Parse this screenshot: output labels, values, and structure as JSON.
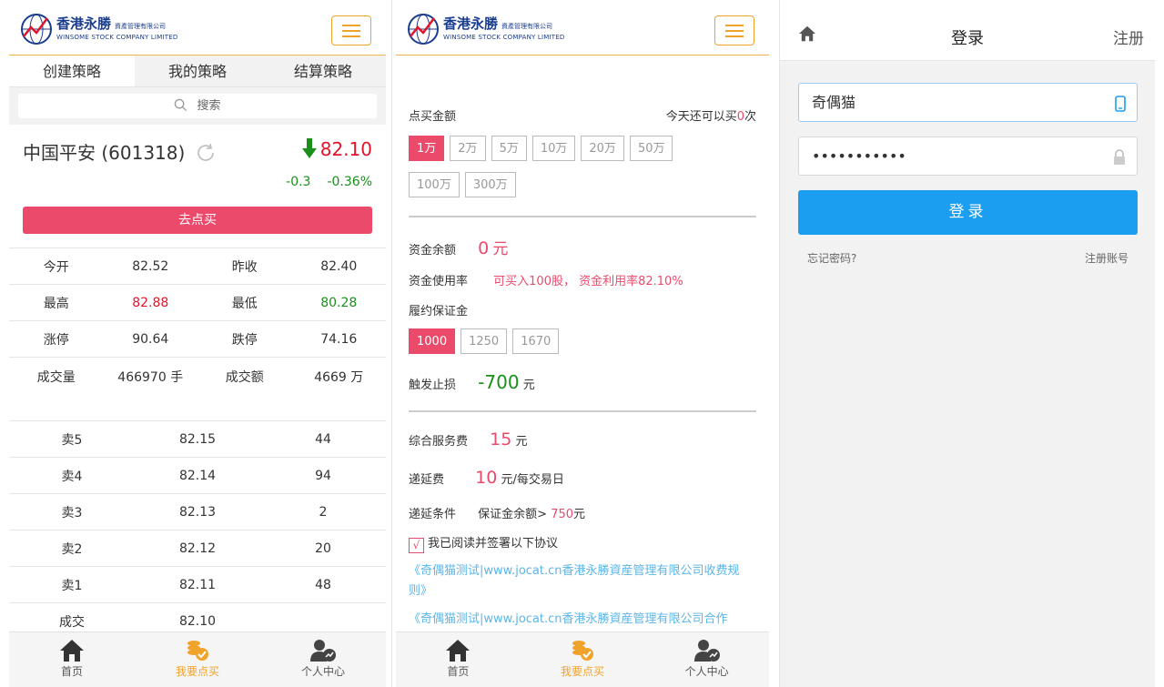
{
  "brand": {
    "name_cn": "香港永勝",
    "name_cn_small": "資產管理有限公司",
    "name_en": "WINSOME STOCK COMPANY LIMITED"
  },
  "left": {
    "tabs": [
      "创建策略",
      "我的策略",
      "结算策略"
    ],
    "search_label": "搜索",
    "stock_name": "中国平安 (601318)",
    "price": "82.10",
    "change": "-0.3",
    "change_pct": "-0.36%",
    "buy_button": "去点买",
    "quote_rows": [
      {
        "k1": "今开",
        "v1": "82.52",
        "k2": "昨收",
        "v2": "82.40"
      },
      {
        "k1": "最高",
        "v1": "82.88",
        "k2": "最低",
        "v2": "80.28"
      },
      {
        "k1": "涨停",
        "v1": "90.64",
        "k2": "跌停",
        "v2": "74.16"
      },
      {
        "k1": "成交量",
        "v1": "466970 手",
        "k2": "成交额",
        "v2": "4669 万"
      }
    ],
    "orders": [
      {
        "label": "卖5",
        "price": "82.15",
        "vol": "44"
      },
      {
        "label": "卖4",
        "price": "82.14",
        "vol": "94"
      },
      {
        "label": "卖3",
        "price": "82.13",
        "vol": "2"
      },
      {
        "label": "卖2",
        "price": "82.12",
        "vol": "20"
      },
      {
        "label": "卖1",
        "price": "82.11",
        "vol": "48"
      },
      {
        "label": "成交",
        "price": "82.10",
        "vol": ""
      }
    ]
  },
  "nav": {
    "home": "首页",
    "buy": "我要点买",
    "me": "个人中心"
  },
  "middle": {
    "amount_label": "点买金额",
    "remaining_prefix": "今天还可以买",
    "remaining_count": "0",
    "remaining_suffix": "次",
    "amounts": [
      "1万",
      "2万",
      "5万",
      "10万",
      "20万",
      "50万",
      "100万",
      "300万"
    ],
    "balance_label": "资金余额",
    "balance_value": "0",
    "balance_unit": "元",
    "usage_label": "资金使用率",
    "usage_value": "可买入100股， 资金利用率82.10%",
    "margin_label": "履约保证金",
    "margins": [
      "1000",
      "1250",
      "1670"
    ],
    "stoploss_label": "触发止损",
    "stoploss_value": "-700",
    "stoploss_unit": "元",
    "fee_label": "综合服务费",
    "fee_value": "15",
    "fee_unit": "元",
    "defer_label": "递延费",
    "defer_value": "10",
    "defer_unit": "元/每交易日",
    "defer_cond_label": "递延条件",
    "defer_cond_prefix": "保证金余额>",
    "defer_cond_value": "750",
    "defer_cond_unit": "元",
    "agree_text": "我已阅读并签署以下协议",
    "agree_mark": "√",
    "agreement1": "《奇偶猫测试|www.jocat.cn香港永勝資産管理有限公司收费规则》",
    "agreement2": "《奇偶猫测试|www.jocat.cn香港永勝資産管理有限公司合作"
  },
  "right": {
    "title": "登录",
    "register": "注册",
    "username": "奇偶猫",
    "password": "•••••••••••",
    "login_button": "登录",
    "forgot": "忘记密码?",
    "register_account": "注册账号"
  },
  "colors": {
    "accent": "#f0a32a",
    "pink": "#ec4a6b",
    "blue": "#1c9ef0",
    "red": "#e0142a",
    "green": "#1a8f1a"
  }
}
